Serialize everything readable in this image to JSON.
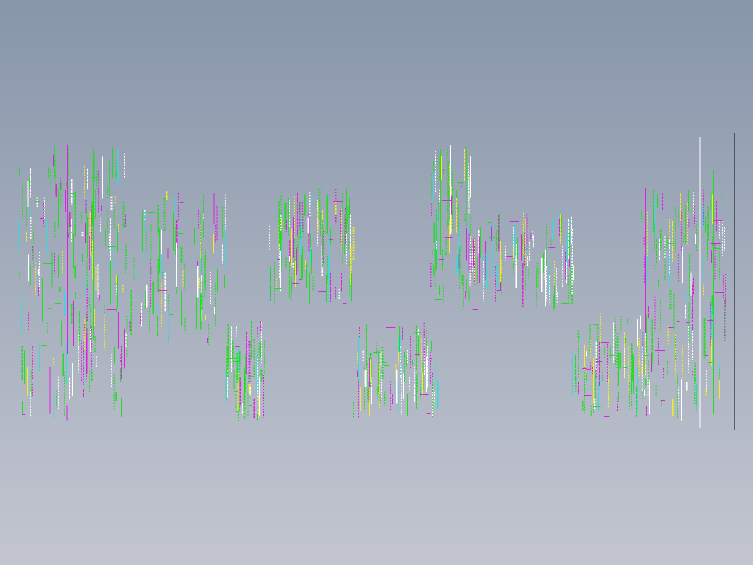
{
  "viewport": {
    "background_top": "#8796AA",
    "background_bottom": "#C3C6D0"
  },
  "palette": {
    "green": "#22DD22",
    "magenta": "#DD22DD",
    "white": "#FFFFFF",
    "cyan": "#33DDDD",
    "yellow": "#EEEE22",
    "dark": "#20232A"
  }
}
